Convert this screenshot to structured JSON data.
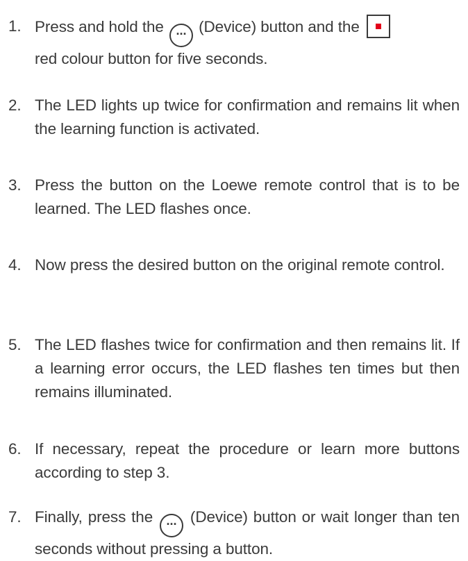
{
  "steps": [
    {
      "number": "1.",
      "parts": [
        "Press and hold the",
        "(Device) button and the",
        "red colour button for five seconds."
      ]
    },
    {
      "number": "2.",
      "text": "The LED lights up twice for confirmation and remains lit when the learning function is activated."
    },
    {
      "number": "3.",
      "text": "Press the button on the Loewe remote control that is to be learned. The LED flashes once."
    },
    {
      "number": "4.",
      "text": "Now press the desired button on the original remote control."
    },
    {
      "number": "5.",
      "text": "The LED flashes twice for confirmation and then remains lit. If a learning error occurs, the LED flashes ten times but then remains illuminated."
    },
    {
      "number": "6.",
      "text": "If necessary, repeat the procedure or learn more buttons according to step 3."
    },
    {
      "number": "7.",
      "parts": [
        "Finally, press the",
        "(Device) button or wait longer than ten seconds without pressing a button."
      ]
    }
  ],
  "icons": {
    "device_button": "device-button-icon",
    "device_button_glyph": "···",
    "red_button": "red-colour-button-icon",
    "red_color": "#e2001a"
  }
}
